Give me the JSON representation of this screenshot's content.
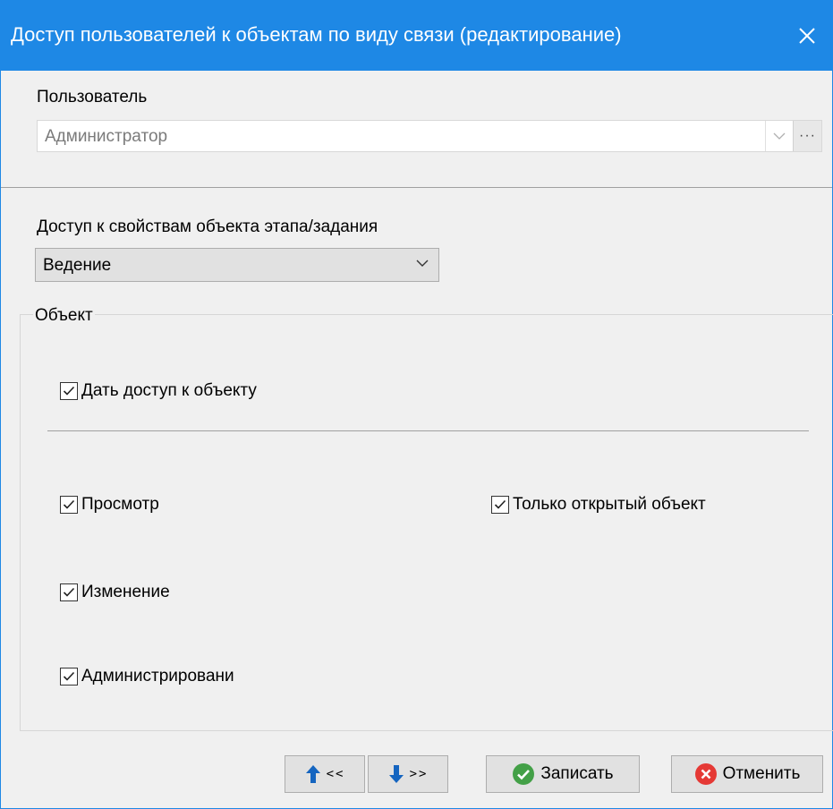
{
  "window": {
    "title": "Доступ пользователей к объектам по виду связи (редактирование)"
  },
  "user": {
    "label": "Пользователь",
    "value": "Администратор",
    "more_label": "···"
  },
  "access": {
    "label": "Доступ к свойствам объекта этапа/задания",
    "value": "Ведение"
  },
  "object_group": {
    "title": "Объект",
    "grant_access": {
      "label": "Дать доступ к объекту",
      "checked": true
    },
    "view": {
      "label": "Просмотр",
      "checked": true
    },
    "only_open": {
      "label": "Только открытый объект",
      "checked": true
    },
    "change": {
      "label": "Изменение",
      "checked": true
    },
    "admin": {
      "label": "Администрировани",
      "checked": true
    }
  },
  "buttons": {
    "prev_label": "<<",
    "next_label": ">>",
    "save_label": "Записать",
    "cancel_label": "Отменить"
  },
  "colors": {
    "titlebar": "#1e88e5",
    "save_icon": "#43a047",
    "cancel_icon": "#e53935",
    "arrow_icon": "#1565c0"
  },
  "icons": {
    "close": "close-icon",
    "prev": "arrow-up-icon",
    "next": "arrow-down-icon",
    "save": "check-circle-icon",
    "cancel": "x-circle-icon"
  }
}
